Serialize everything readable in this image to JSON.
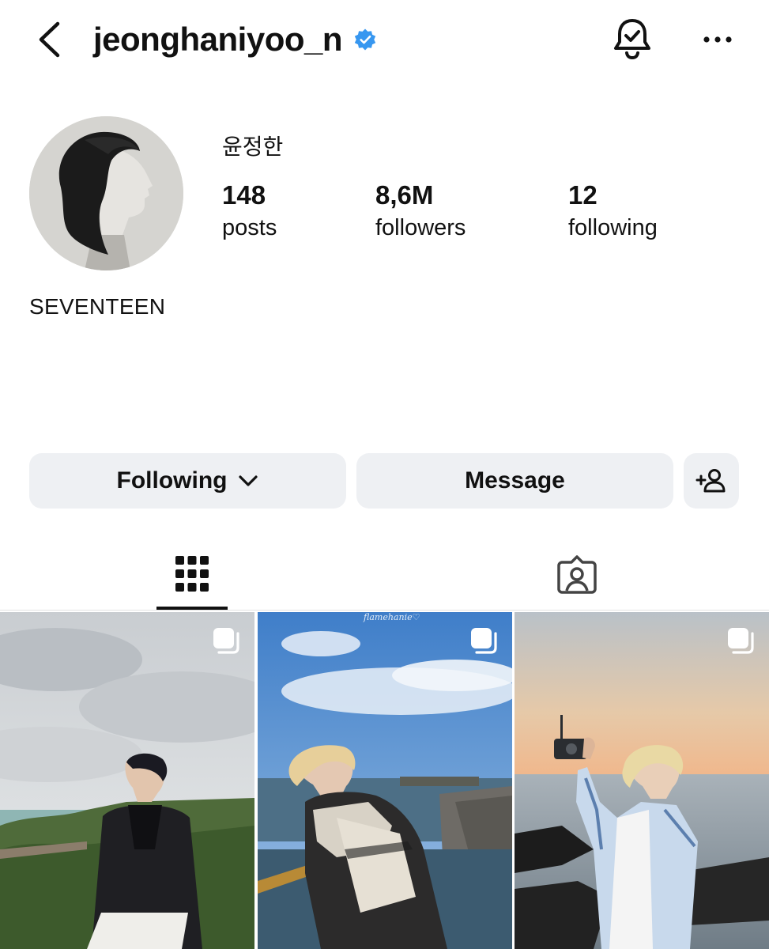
{
  "header": {
    "username": "jeonghaniyoo_n",
    "verified": true,
    "icons": [
      "back-arrow-icon",
      "verified-badge-icon",
      "notification-bell-icon",
      "more-options-icon"
    ]
  },
  "profile": {
    "name": "윤정한",
    "stats": {
      "posts": {
        "count": "148",
        "label": "posts"
      },
      "followers": {
        "count": "8,6M",
        "label": "followers"
      },
      "following": {
        "count": "12",
        "label": "following"
      }
    },
    "bio": "SEVENTEEN"
  },
  "actions": {
    "following_label": "Following",
    "message_label": "Message"
  },
  "tabs": {
    "active": "grid",
    "items": [
      "grid-icon",
      "tagged-icon"
    ]
  },
  "posts": [
    {
      "type": "carousel"
    },
    {
      "type": "carousel",
      "watermark": "flamehanie♡"
    },
    {
      "type": "carousel"
    }
  ],
  "colors": {
    "verified_blue": "#3797f0",
    "button_bg": "#eef0f3",
    "text": "#111111"
  }
}
